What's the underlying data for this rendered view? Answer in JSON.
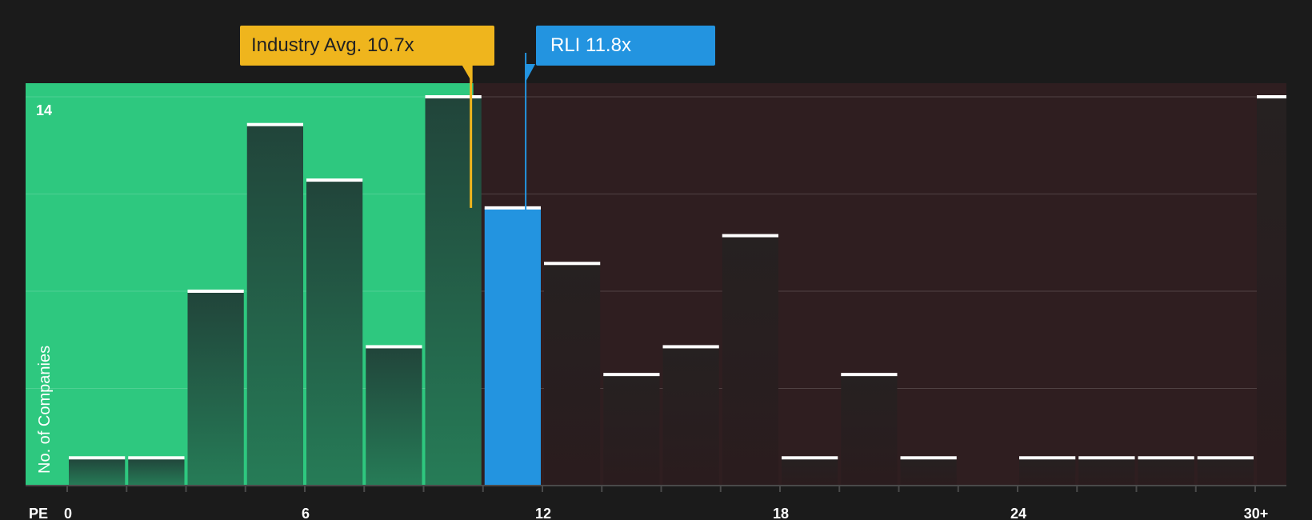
{
  "chart_data": {
    "type": "bar",
    "title": "",
    "xlabel": "PE",
    "ylabel": "No. of Companies",
    "bin_width": 1.5,
    "x_ticks": [
      {
        "value": 0,
        "label": "0"
      },
      {
        "value": 6,
        "label": "6"
      },
      {
        "value": 12,
        "label": "12"
      },
      {
        "value": 18,
        "label": "18"
      },
      {
        "value": 24,
        "label": "24"
      },
      {
        "value": 30,
        "label": "30+"
      }
    ],
    "y_tick_labels": [
      {
        "value": 14,
        "label": "14"
      }
    ],
    "ylim": [
      0,
      14
    ],
    "y_gridlines": [
      0,
      3.5,
      7,
      10.5,
      14
    ],
    "bins": [
      {
        "x0": 0,
        "count": 1
      },
      {
        "x0": 1.5,
        "count": 1
      },
      {
        "x0": 3,
        "count": 7
      },
      {
        "x0": 4.5,
        "count": 13
      },
      {
        "x0": 6,
        "count": 11
      },
      {
        "x0": 7.5,
        "count": 5
      },
      {
        "x0": 9,
        "count": 14
      },
      {
        "x0": 10.5,
        "count": 10
      },
      {
        "x0": 12,
        "count": 8
      },
      {
        "x0": 13.5,
        "count": 4
      },
      {
        "x0": 15,
        "count": 5
      },
      {
        "x0": 16.5,
        "count": 9
      },
      {
        "x0": 18,
        "count": 1
      },
      {
        "x0": 19.5,
        "count": 4
      },
      {
        "x0": 21,
        "count": 1
      },
      {
        "x0": 22.5,
        "count": 0
      },
      {
        "x0": 24,
        "count": 1
      },
      {
        "x0": 25.5,
        "count": 1
      },
      {
        "x0": 27,
        "count": 1
      },
      {
        "x0": 28.5,
        "count": 1
      },
      {
        "x0": 30,
        "count": 14
      }
    ],
    "highlight_bin_x0": 10.5,
    "industry_avg": {
      "label": "Industry Avg. 10.7x",
      "value": 10.7
    },
    "company": {
      "label": "RLI 11.8x",
      "value": 11.8
    },
    "colors": {
      "background": "#1b1b1b",
      "undervalued_region": "#2ec87f",
      "overvalued_region": "#2f1e20",
      "bar_in_green": "#22473a",
      "bar_in_red": "#262121",
      "highlight_bar": "#2394e0",
      "industry_marker": "#efb51d",
      "company_marker": "#2394e0",
      "bar_cap": "#ffffff"
    }
  }
}
